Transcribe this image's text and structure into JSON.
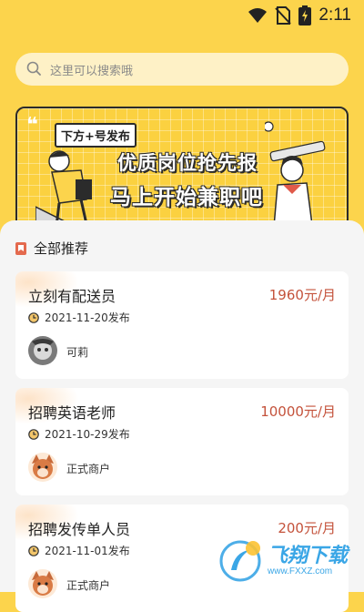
{
  "status": {
    "time": "2:11"
  },
  "search": {
    "placeholder": "这里可以搜索哦"
  },
  "banner": {
    "quote": "❝",
    "tag": "下方+号发布",
    "line1": "优质岗位抢先报",
    "line2": "马上开始兼职吧"
  },
  "section": {
    "title": "全部推荐"
  },
  "jobs": [
    {
      "title": "立刻有配送员",
      "salary": "1960元/月",
      "date": "2021-11-20发布",
      "author": "可莉"
    },
    {
      "title": "招聘英语老师",
      "salary": "10000元/月",
      "date": "2021-10-29发布",
      "author": "正式商户"
    },
    {
      "title": "招聘发传单人员",
      "salary": "200元/月",
      "date": "2021-11-01发布",
      "author": "正式商户"
    }
  ],
  "watermark": {
    "name": "飞翔下载",
    "url": "www.FXXZ.com"
  },
  "colors": {
    "accent": "#fcd44c",
    "salary": "#c4523b",
    "card": "#ffffff"
  }
}
